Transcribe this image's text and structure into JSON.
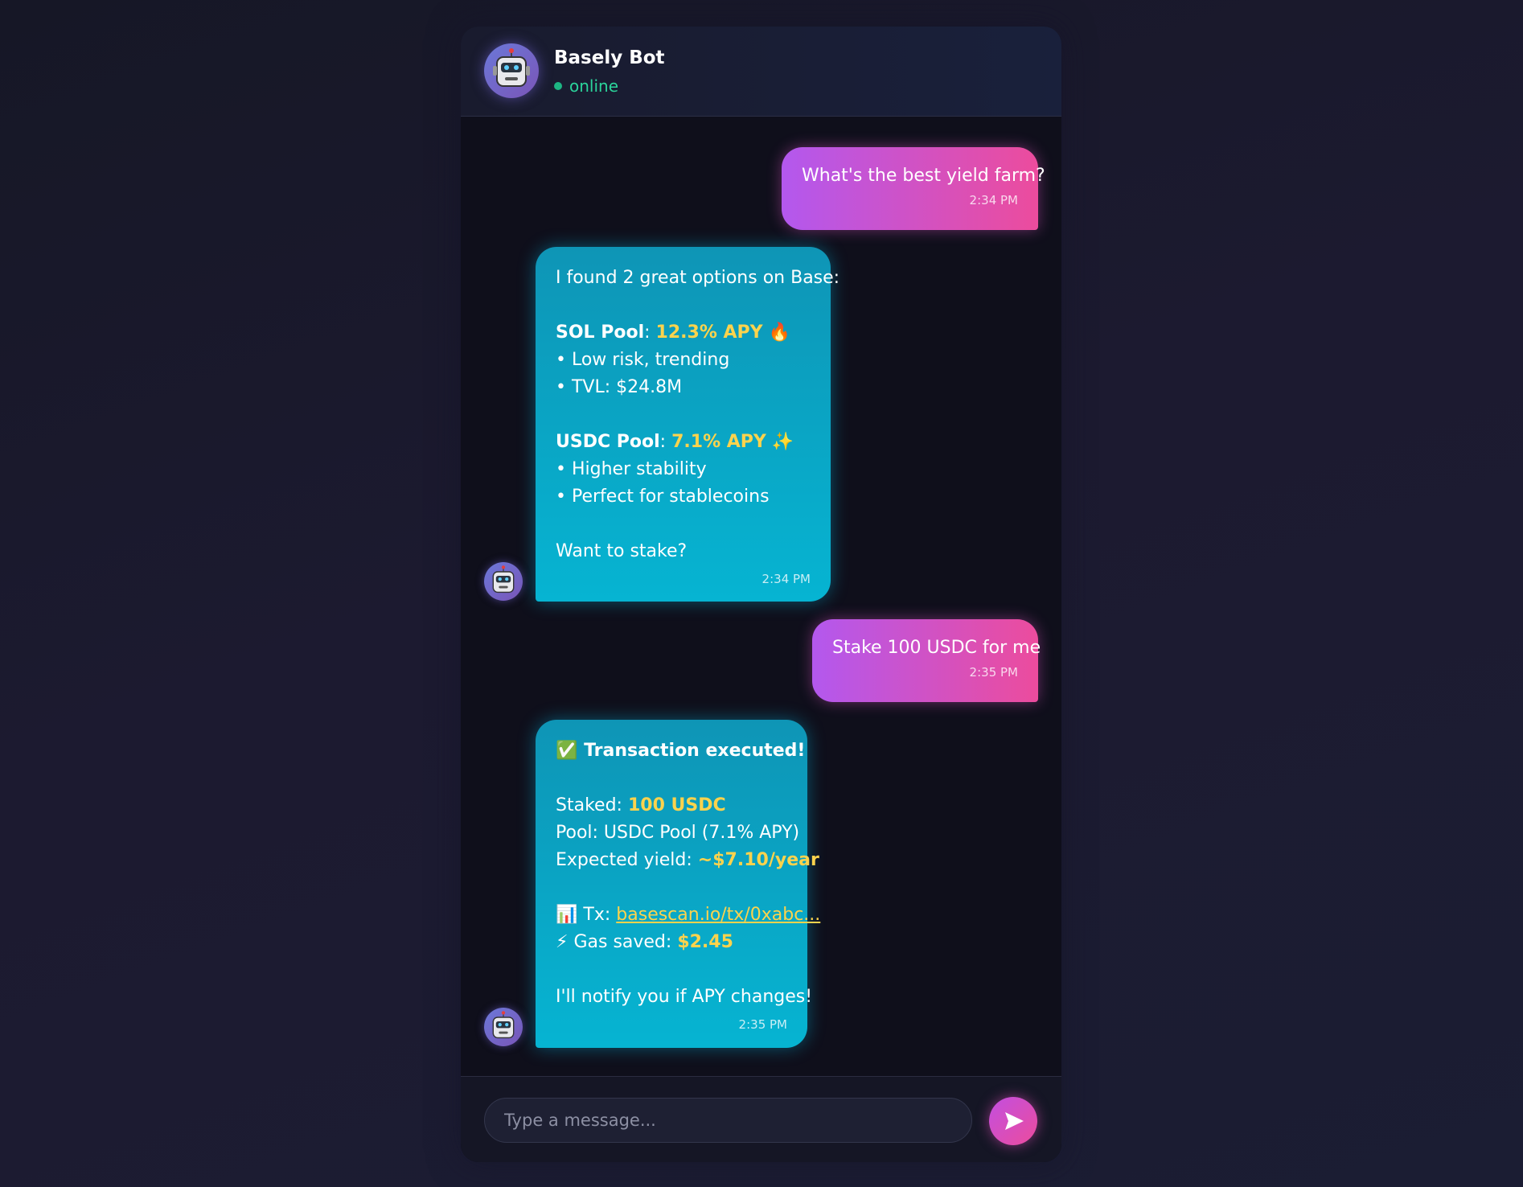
{
  "header": {
    "bot_name": "Basely Bot",
    "status": "online",
    "avatar_icon": "robot-icon"
  },
  "messages": [
    {
      "sender": "user",
      "text": "What's the best yield farm?",
      "time": "2:34 PM"
    },
    {
      "sender": "bot",
      "intro": "I found 2 great options on Base:",
      "sol_pool": {
        "name": "SOL Pool",
        "sep": ":",
        "apy": "12.3% APY",
        "emoji": "🔥",
        "bullets": [
          "• Low risk, trending",
          "• TVL: $24.8M"
        ]
      },
      "usdc_pool": {
        "name": "USDC Pool",
        "sep": ":",
        "apy": "7.1% APY",
        "emoji": "✨",
        "bullets": [
          "• Higher stability",
          "• Perfect for stablecoins"
        ]
      },
      "outro": "Want to stake?",
      "time": "2:34 PM"
    },
    {
      "sender": "user",
      "text": "Stake 100 USDC for me",
      "time": "2:35 PM"
    },
    {
      "sender": "bot",
      "title_emoji": "✅",
      "title": "Transaction executed!",
      "staked_label": "Staked:",
      "staked_value": "100 USDC",
      "pool_line": "Pool: USDC Pool (7.1% APY)",
      "yield_label": "Expected yield:",
      "yield_value": "~$7.10/year",
      "tx_emoji": "📊",
      "tx_label": "Tx:",
      "tx_link": "basescan.io/tx/0xabc...",
      "gas_emoji": "⚡",
      "gas_label": "Gas saved:",
      "gas_value": "$2.45",
      "outro": "I'll notify you if APY changes!",
      "time": "2:35 PM"
    }
  ],
  "composer": {
    "placeholder": "Type a message...",
    "send_icon": "send-arrow-icon"
  },
  "colors": {
    "user_bubble": [
      "#b358ee",
      "#ec4c9d"
    ],
    "bot_bubble": [
      "#0e95b6",
      "#06b4d2"
    ],
    "highlight": "#fcd34d",
    "online": "#2bd49b",
    "window_bg": "#0f0f1b"
  }
}
